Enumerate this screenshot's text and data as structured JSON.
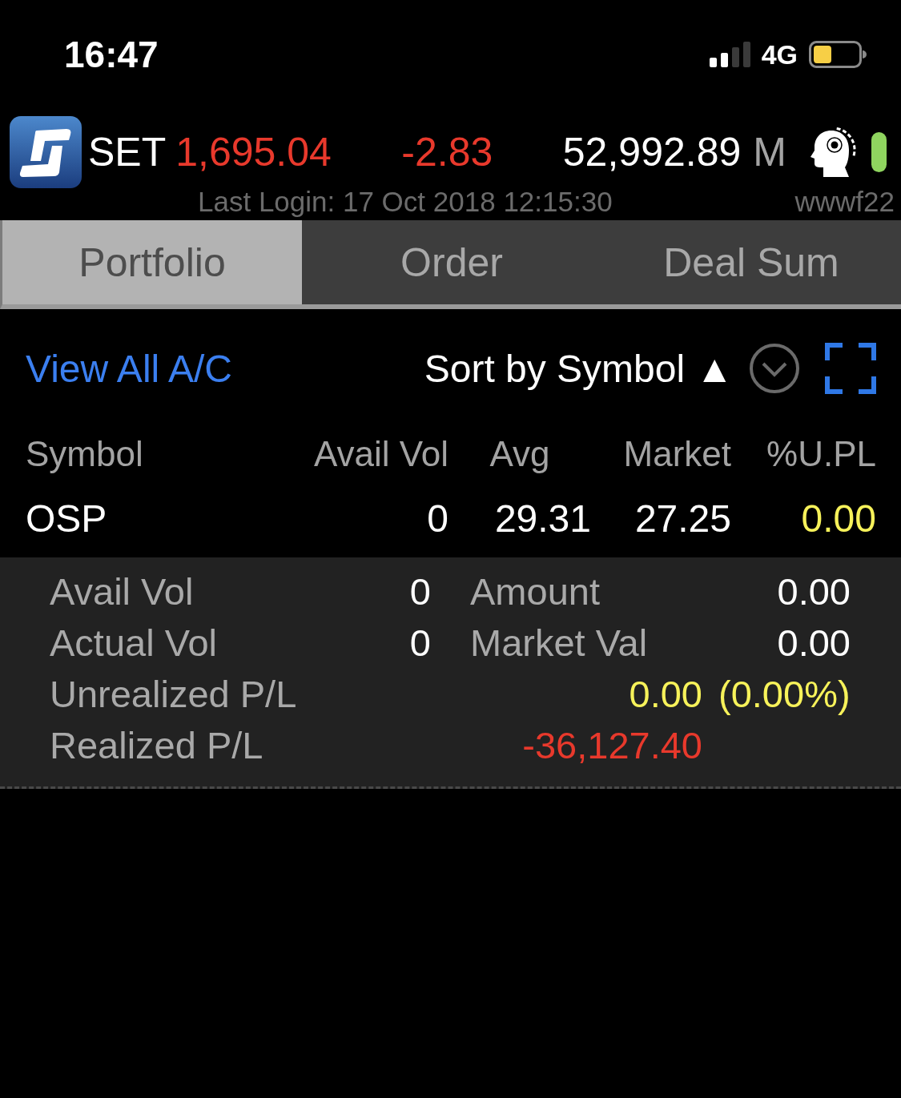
{
  "status_bar": {
    "time": "16:47",
    "network": "4G"
  },
  "market_header": {
    "index_name": "SET",
    "index_value": "1,695.04",
    "change": "-2.83",
    "color": "#e8392c",
    "turnover": "52,992.89",
    "turnover_unit": "M",
    "last_login": "Last Login: 17 Oct 2018 12:15:30",
    "user_id": "wwwf22"
  },
  "tabs": [
    {
      "label": "Portfolio",
      "selected": true
    },
    {
      "label": "Order",
      "selected": false
    },
    {
      "label": "Deal Sum",
      "selected": false
    }
  ],
  "toolbar": {
    "account_link": "View All A/C",
    "sort_label": "Sort by Symbol",
    "sort_direction": "▲"
  },
  "table": {
    "columns": [
      "Symbol",
      "Avail Vol",
      "Avg",
      "Market",
      "%U.PL"
    ],
    "rows": [
      {
        "cells": [
          "OSP",
          "0",
          "29.31",
          "27.25",
          "0.00"
        ],
        "color": "#f7f25a",
        "expanded": true,
        "details": [
          {
            "kind": "pair",
            "items": [
              {
                "label": "Avail Vol",
                "value": "0"
              },
              {
                "label": "Amount",
                "value": "0.00"
              }
            ]
          },
          {
            "kind": "pair",
            "items": [
              {
                "label": "Actual Vol",
                "value": "0"
              },
              {
                "label": "Market Val",
                "value": "0.00"
              }
            ]
          },
          {
            "kind": "pl",
            "label": "Unrealized P/L",
            "value": "0.00",
            "percent": "(0.00%)",
            "color": "#f7f25a"
          },
          {
            "kind": "pl",
            "label": "Realized P/L",
            "value": "-36,127.40",
            "color": "#e8392c"
          }
        ]
      }
    ]
  }
}
